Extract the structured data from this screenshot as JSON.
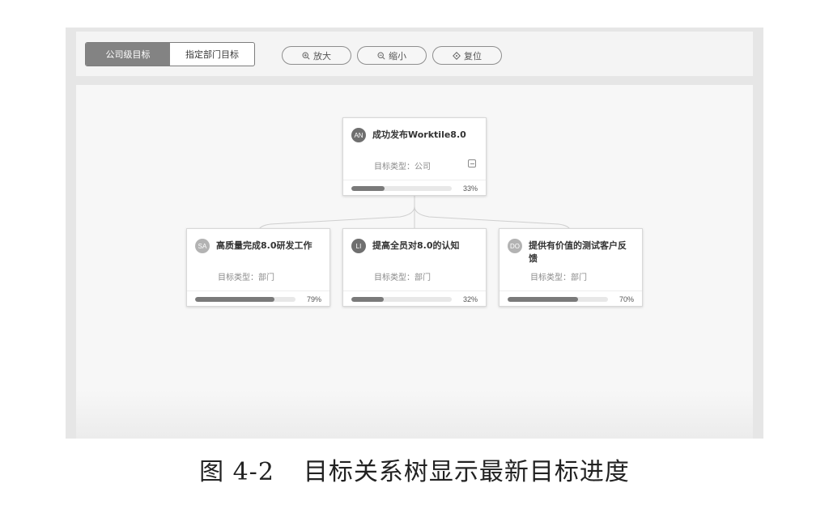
{
  "toolbar": {
    "tabs": [
      {
        "label": "公司级目标",
        "active": true
      },
      {
        "label": "指定部门目标",
        "active": false
      }
    ],
    "zoom_in_label": "放大",
    "zoom_out_label": "缩小",
    "reset_label": "复位",
    "icons": {
      "zoom_in": "zoom-in-icon",
      "zoom_out": "zoom-out-icon",
      "reset": "crosshair-icon"
    }
  },
  "tree": {
    "root": {
      "avatar": "AN",
      "title": "成功发布Worktile8.0",
      "type": "目标类型：公司",
      "progress": 33,
      "progress_label": "33%"
    },
    "children": [
      {
        "avatar": "SA",
        "title": "高质量完成8.0研发工作",
        "type": "目标类型：部门",
        "progress": 79,
        "progress_label": "79%"
      },
      {
        "avatar": "LI",
        "title": "提高全员对8.0的认知",
        "type": "目标类型：部门",
        "progress": 32,
        "progress_label": "32%"
      },
      {
        "avatar": "DO",
        "title": "提供有价值的测试客户反馈",
        "type": "目标类型：部门",
        "progress": 70,
        "progress_label": "70%"
      }
    ]
  },
  "caption": {
    "number": "图 4-2",
    "text": "目标关系树显示最新目标进度"
  },
  "colors": {
    "progress_fill": "#7a7a7a",
    "progress_track": "#e8e8e8",
    "active_tab": "#838383"
  }
}
